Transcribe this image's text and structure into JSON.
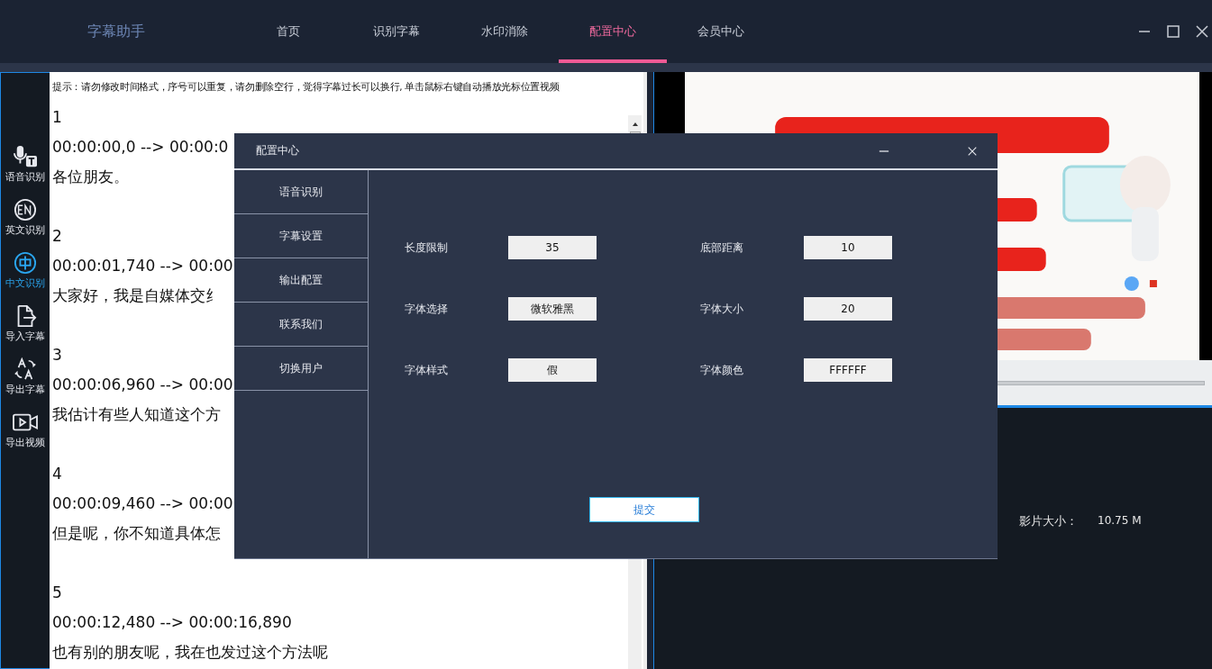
{
  "app": {
    "title": "字幕助手"
  },
  "nav_tabs": [
    {
      "label": "首页",
      "selected": false
    },
    {
      "label": "识别字幕",
      "selected": false
    },
    {
      "label": "水印消除",
      "selected": false
    },
    {
      "label": "配置中心",
      "selected": true
    },
    {
      "label": "会员中心",
      "selected": false
    }
  ],
  "sidebar": {
    "items": [
      {
        "label": "语音识别",
        "kind": "mic",
        "selected": false
      },
      {
        "label": "英文识别",
        "kind": "en",
        "selected": false
      },
      {
        "label": "中文识别",
        "kind": "zh",
        "selected": true
      },
      {
        "label": "导入字幕",
        "kind": "import",
        "selected": false
      },
      {
        "label": "导出字幕",
        "kind": "translate",
        "selected": false
      },
      {
        "label": "导出视频",
        "kind": "video",
        "selected": false
      }
    ]
  },
  "editor": {
    "hint": "提示：请勿修改时间格式，序号可以重复，请勿删除空行，觉得字幕过长可以换行, 单击鼠标右键自动播放光标位置视频",
    "entries": [
      {
        "index": "1",
        "time": "00:00:00,0 --> 00:00:0",
        "text": "各位朋友。"
      },
      {
        "index": "2",
        "time": "00:00:01,740 --> 00:00",
        "text": "大家好，我是自媒体交纟"
      },
      {
        "index": "3",
        "time": "00:00:06,960 --> 00:00",
        "text": "我估计有些人知道这个方"
      },
      {
        "index": "4",
        "time": "00:00:09,460 --> 00:00",
        "text": "但是呢，你不知道具体怎"
      },
      {
        "index": "5",
        "time": "00:00:12,480 --> 00:00:16,890",
        "text": "也有别的朋友呢，我在也发过这个方法呢"
      }
    ]
  },
  "info": {
    "label": "影片大小：",
    "value": "10.75 M"
  },
  "dialog": {
    "title": "配置中心",
    "menu": [
      "语音识别",
      "字幕设置",
      "输出配置",
      "联系我们",
      "切换用户"
    ],
    "fields": [
      {
        "label": "长度限制",
        "value": "35"
      },
      {
        "label": "底部距离",
        "value": "10"
      },
      {
        "label": "字体选择",
        "value": "微软雅黑"
      },
      {
        "label": "字体大小",
        "value": "20"
      },
      {
        "label": "字体样式",
        "value": "假"
      },
      {
        "label": "字体颜色",
        "value": "FFFFFF"
      }
    ],
    "submit": "提交"
  }
}
